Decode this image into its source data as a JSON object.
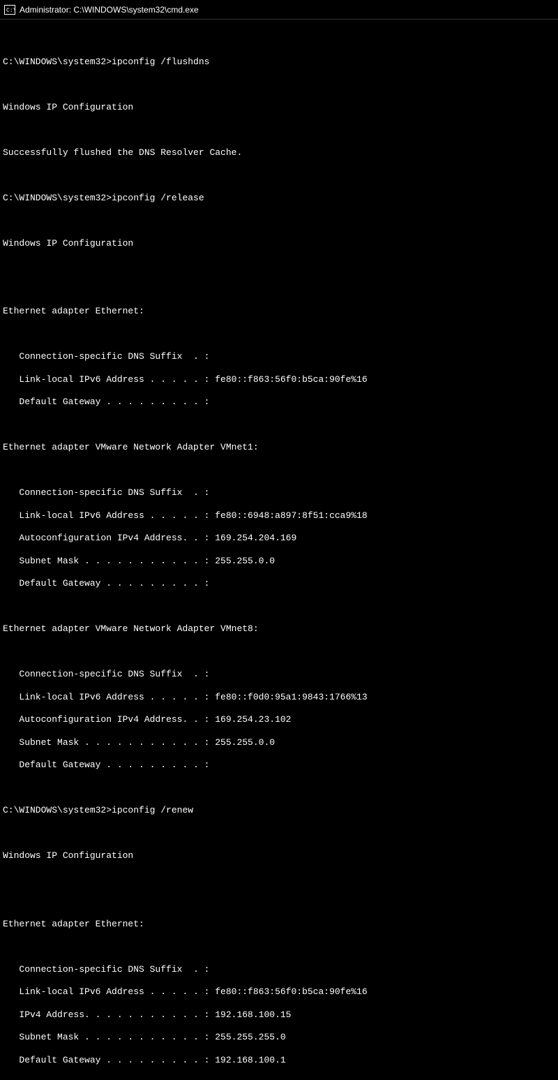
{
  "titlebar": {
    "text": "Administrator: C:\\WINDOWS\\system32\\cmd.exe"
  },
  "lines": {
    "l0": "",
    "l1": "C:\\WINDOWS\\system32>ipconfig /flushdns",
    "l2": "",
    "l3": "Windows IP Configuration",
    "l4": "",
    "l5": "Successfully flushed the DNS Resolver Cache.",
    "l6": "",
    "l7": "C:\\WINDOWS\\system32>ipconfig /release",
    "l8": "",
    "l9": "Windows IP Configuration",
    "l10": "",
    "l11": "",
    "l12": "Ethernet adapter Ethernet:",
    "l13": "",
    "l14": "   Connection-specific DNS Suffix  . :",
    "l15": "   Link-local IPv6 Address . . . . . : fe80::f863:56f0:b5ca:90fe%16",
    "l16": "   Default Gateway . . . . . . . . . :",
    "l17": "",
    "l18": "Ethernet adapter VMware Network Adapter VMnet1:",
    "l19": "",
    "l20": "   Connection-specific DNS Suffix  . :",
    "l21": "   Link-local IPv6 Address . . . . . : fe80::6948:a897:8f51:cca9%18",
    "l22": "   Autoconfiguration IPv4 Address. . : 169.254.204.169",
    "l23": "   Subnet Mask . . . . . . . . . . . : 255.255.0.0",
    "l24": "   Default Gateway . . . . . . . . . :",
    "l25": "",
    "l26": "Ethernet adapter VMware Network Adapter VMnet8:",
    "l27": "",
    "l28": "   Connection-specific DNS Suffix  . :",
    "l29": "   Link-local IPv6 Address . . . . . : fe80::f0d0:95a1:9843:1766%13",
    "l30": "   Autoconfiguration IPv4 Address. . : 169.254.23.102",
    "l31": "   Subnet Mask . . . . . . . . . . . : 255.255.0.0",
    "l32": "   Default Gateway . . . . . . . . . :",
    "l33": "",
    "l34": "C:\\WINDOWS\\system32>ipconfig /renew",
    "l35": "",
    "l36": "Windows IP Configuration",
    "l37": "",
    "l38": "",
    "l39": "Ethernet adapter Ethernet:",
    "l40": "",
    "l41": "   Connection-specific DNS Suffix  . :",
    "l42": "   Link-local IPv6 Address . . . . . : fe80::f863:56f0:b5ca:90fe%16",
    "l43": "   IPv4 Address. . . . . . . . . . . : 192.168.100.15",
    "l44": "   Subnet Mask . . . . . . . . . . . : 255.255.255.0",
    "l45": "   Default Gateway . . . . . . . . . : 192.168.100.1"
  }
}
